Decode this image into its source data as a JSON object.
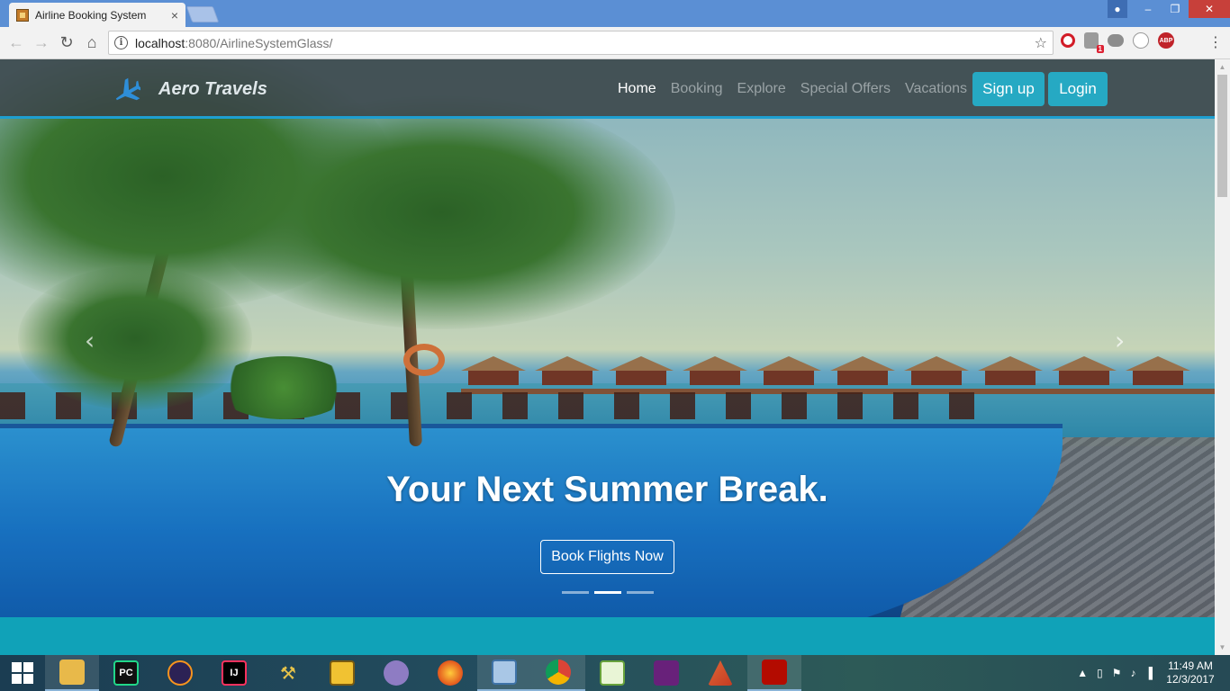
{
  "browser": {
    "tab_title": "Airline Booking System",
    "tab_close": "×",
    "url_host": "localhost",
    "url_rest": ":8080/AirlineSystemGlass/",
    "abp_label": "ABP",
    "shield_badge": "1"
  },
  "site": {
    "brand": "Aero Travels",
    "nav": [
      {
        "label": "Home",
        "active": true
      },
      {
        "label": "Booking"
      },
      {
        "label": "Explore"
      },
      {
        "label": "Special Offers"
      },
      {
        "label": "Vacations"
      }
    ],
    "signup": "Sign up",
    "login": "Login",
    "hero": {
      "headline": "Your Next Summer Break.",
      "cta": "Book Flights Now",
      "active_slide": 2,
      "slide_count": 3
    }
  },
  "taskbar": {
    "apps": [
      "file-explorer",
      "pycharm",
      "eclipse",
      "intellij",
      "tools",
      "archive",
      "arc",
      "firefox",
      "virtualbox",
      "chrome",
      "notepad-plus",
      "visual-studio",
      "matlab",
      "acrobat"
    ],
    "pycharm_label": "PC",
    "intellij_label": "IJ",
    "time": "11:49 AM",
    "date": "12/3/2017"
  },
  "colors": {
    "accent": "#26a9c3",
    "navbar_border": "#1e9fd0",
    "teal_band": "#10a2b8",
    "title_bar": "#5b8fd4"
  }
}
